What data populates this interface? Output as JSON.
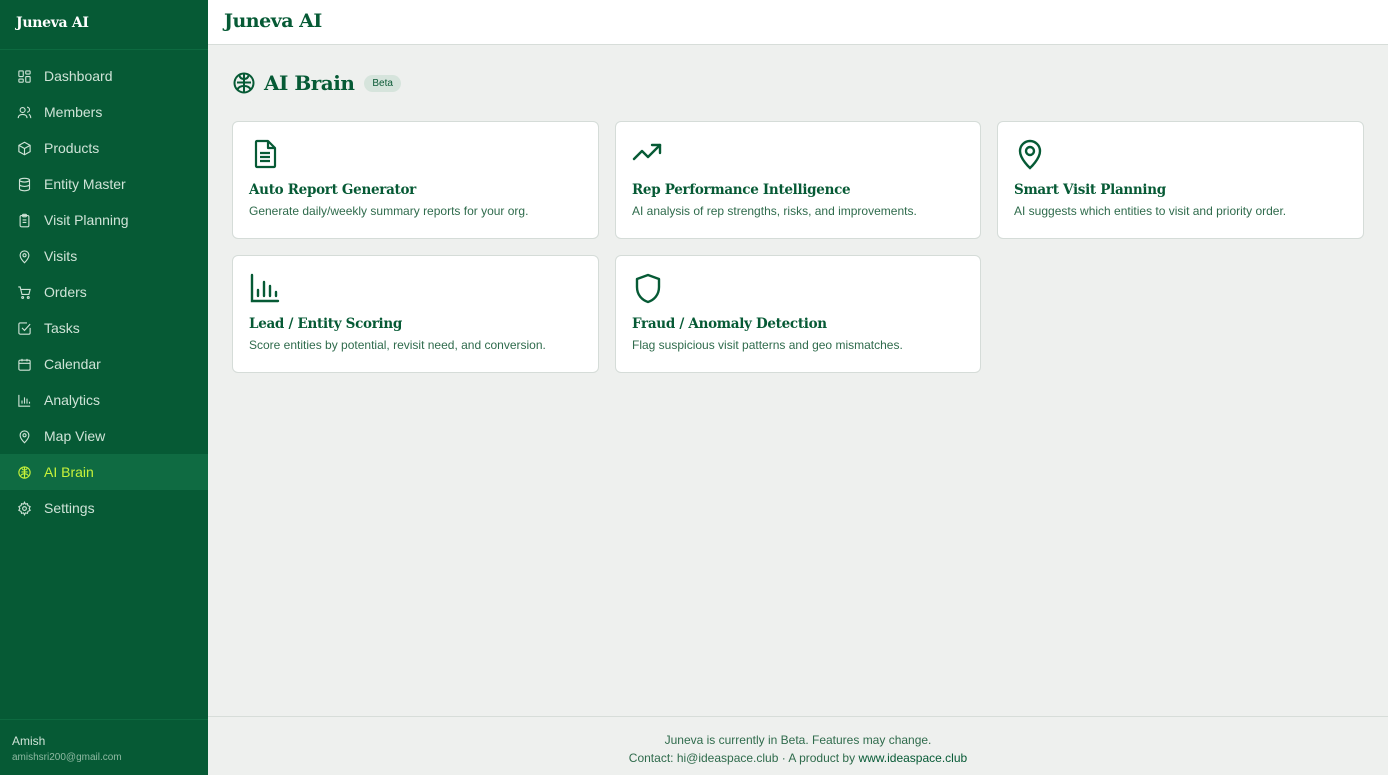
{
  "app": {
    "brand": "Juneva AI",
    "header_title": "Juneva AI"
  },
  "sidebar": {
    "items": [
      {
        "label": "Dashboard",
        "icon": "dashboard-icon"
      },
      {
        "label": "Members",
        "icon": "users-icon"
      },
      {
        "label": "Products",
        "icon": "box-icon"
      },
      {
        "label": "Entity Master",
        "icon": "database-icon"
      },
      {
        "label": "Visit Planning",
        "icon": "clipboard-icon"
      },
      {
        "label": "Visits",
        "icon": "map-pin-icon"
      },
      {
        "label": "Orders",
        "icon": "cart-icon"
      },
      {
        "label": "Tasks",
        "icon": "checkbox-icon"
      },
      {
        "label": "Calendar",
        "icon": "calendar-icon"
      },
      {
        "label": "Analytics",
        "icon": "bar-chart-icon"
      },
      {
        "label": "Map View",
        "icon": "map-pin-icon"
      },
      {
        "label": "AI Brain",
        "icon": "brain-icon",
        "active": true
      },
      {
        "label": "Settings",
        "icon": "gear-icon"
      }
    ],
    "user": {
      "name": "Amish",
      "email": "amishsri200@gmail.com"
    }
  },
  "page": {
    "title": "AI Brain",
    "badge": "Beta",
    "cards": [
      {
        "title": "Auto Report Generator",
        "desc": "Generate daily/weekly summary reports for your org.",
        "icon": "document-icon"
      },
      {
        "title": "Rep Performance Intelligence",
        "desc": "AI analysis of rep strengths, risks, and improvements.",
        "icon": "trending-up-icon"
      },
      {
        "title": "Smart Visit Planning",
        "desc": "AI suggests which entities to visit and priority order.",
        "icon": "map-pin-icon"
      },
      {
        "title": "Lead / Entity Scoring",
        "desc": "Score entities by potential, revisit need, and conversion.",
        "icon": "bar-chart-icon"
      },
      {
        "title": "Fraud / Anomaly Detection",
        "desc": "Flag suspicious visit patterns and geo mismatches.",
        "icon": "shield-icon"
      }
    ]
  },
  "footer": {
    "line1": "Juneva is currently in Beta. Features may change.",
    "contact_prefix": "Contact: hi@ideaspace.club · A product by ",
    "link": "www.ideaspace.club"
  },
  "colors": {
    "sidebar_bg": "#065a35",
    "accent": "#c7f23a",
    "page_bg": "#eef0ee",
    "text_green": "#065a35"
  }
}
